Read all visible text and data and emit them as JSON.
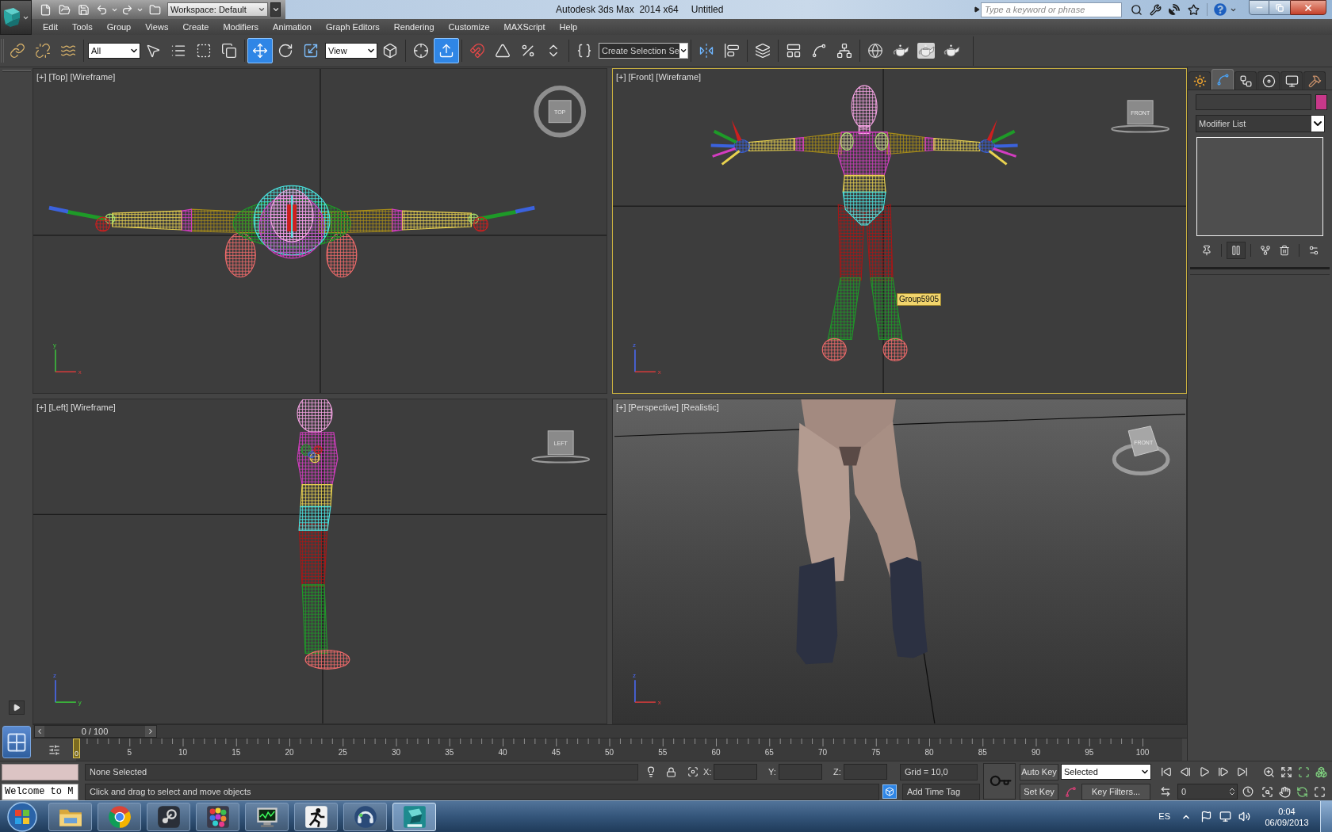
{
  "title_bar": {
    "workspace": "Workspace: Default",
    "app_title": "Autodesk 3ds Max  2014 x64",
    "document": "Untitled",
    "search": {
      "placeholder": "Type a keyword or phrase"
    }
  },
  "menu_bar": [
    "Edit",
    "Tools",
    "Group",
    "Views",
    "Create",
    "Modifiers",
    "Animation",
    "Graph Editors",
    "Rendering",
    "Customize",
    "MAXScript",
    "Help"
  ],
  "main_toolbar": [
    {
      "items": [
        {
          "kind": "button",
          "selected": false
        },
        {
          "kind": "button",
          "selected": false
        },
        {
          "kind": "button",
          "selected": false
        }
      ]
    },
    {
      "items": [
        {
          "kind": "dropdown",
          "value": "All"
        },
        {
          "kind": "button",
          "selected": false
        },
        {
          "kind": "button",
          "selected": false
        },
        {
          "kind": "button",
          "selected": false
        },
        {
          "kind": "button",
          "selected": false
        }
      ]
    },
    {
      "items": [
        {
          "kind": "button",
          "selected": true
        },
        {
          "kind": "button",
          "selected": false
        },
        {
          "kind": "button",
          "selected": false
        },
        {
          "kind": "dropdown",
          "value": "View"
        },
        {
          "kind": "button",
          "selected": false
        }
      ]
    },
    {
      "items": [
        {
          "kind": "button",
          "selected": false
        },
        {
          "kind": "button",
          "selected": true
        }
      ]
    },
    {
      "items": [
        {
          "kind": "button",
          "selected": false
        },
        {
          "kind": "button",
          "selected": false
        },
        {
          "kind": "button",
          "selected": false
        },
        {
          "kind": "button",
          "selected": false
        }
      ]
    },
    {
      "items": [
        {
          "kind": "button",
          "selected": false
        },
        {
          "kind": "combo",
          "value": "Create Selection Se"
        }
      ]
    },
    {
      "items": [
        {
          "kind": "button",
          "selected": false
        },
        {
          "kind": "button",
          "selected": false
        }
      ]
    },
    {
      "items": [
        {
          "kind": "button",
          "selected": false
        }
      ]
    },
    {
      "items": [
        {
          "kind": "button",
          "selected": false
        },
        {
          "kind": "button",
          "selected": false
        },
        {
          "kind": "button",
          "selected": false
        }
      ]
    },
    {
      "items": [
        {
          "kind": "button",
          "selected": false
        },
        {
          "kind": "button",
          "selected": false
        },
        {
          "kind": "button",
          "selected": false
        },
        {
          "kind": "button",
          "selected": false
        }
      ]
    }
  ],
  "viewports": [
    {
      "kind": "top",
      "labels": [
        "[+]",
        "[Top]",
        "[Wireframe]"
      ],
      "active": false,
      "viewcube": "TOP",
      "axes": [
        "y",
        "x"
      ]
    },
    {
      "kind": "front",
      "labels": [
        "[+]",
        "[Front]",
        "[Wireframe]"
      ],
      "active": true,
      "viewcube": "FRONT",
      "axes": [
        "z",
        "x"
      ],
      "tooltip": "Group5905"
    },
    {
      "kind": "left",
      "labels": [
        "[+]",
        "[Left]",
        "[Wireframe]"
      ],
      "active": false,
      "viewcube": "LEFT",
      "axes": [
        "z",
        "y"
      ]
    },
    {
      "kind": "perspective",
      "labels": [
        "[+]",
        "[Perspective]",
        "[Realistic]"
      ],
      "active": false,
      "viewcube": "FRONT",
      "axes": [
        "z",
        "x"
      ]
    }
  ],
  "command_panel": {
    "tabs": [
      {
        "selected": false
      },
      {
        "selected": true
      },
      {
        "selected": false
      },
      {
        "selected": false
      },
      {
        "selected": false
      },
      {
        "selected": false
      }
    ],
    "name_swatch": {
      "color": "#c8388a"
    },
    "modifier_list": "Modifier List",
    "stack_buttons": [
      {
        "selected": false
      },
      {
        "selected": true
      },
      {
        "selected": false
      },
      {
        "selected": false
      },
      {
        "selected": false
      }
    ]
  },
  "time_slider": {
    "label": "0 / 100",
    "level": 0
  },
  "trackbar": {
    "marker": "0",
    "labels": [
      "5",
      "10",
      "15",
      "20",
      "25",
      "30",
      "35",
      "40",
      "45",
      "50",
      "55",
      "60",
      "65",
      "70",
      "75",
      "80",
      "85",
      "90",
      "95",
      "100"
    ]
  },
  "status_bar": {
    "selection": "None Selected",
    "prompt": "Click and drag to select and move objects",
    "listener_output": "Welcome to M",
    "coordinates": [
      {
        "label": "X:"
      },
      {
        "label": "Y:"
      },
      {
        "label": "Z:"
      }
    ],
    "grid": "Grid = 10,0",
    "time_tag": "Add Time Tag",
    "degradation": {
      "on": true
    },
    "auto_key": {
      "label": "Auto Key",
      "on": false
    },
    "key_mode": "Selected",
    "set_key": "Set Key",
    "key_filters": "Key Filters...",
    "current_frame": "0"
  },
  "taskbar": {
    "apps": [
      {
        "selected": false
      },
      {
        "selected": false
      },
      {
        "selected": false
      },
      {
        "selected": false
      },
      {
        "selected": false
      },
      {
        "selected": false
      },
      {
        "selected": false
      },
      {
        "selected": true
      }
    ],
    "language": "ES",
    "time": "0:04",
    "date": "06/09/2013"
  }
}
